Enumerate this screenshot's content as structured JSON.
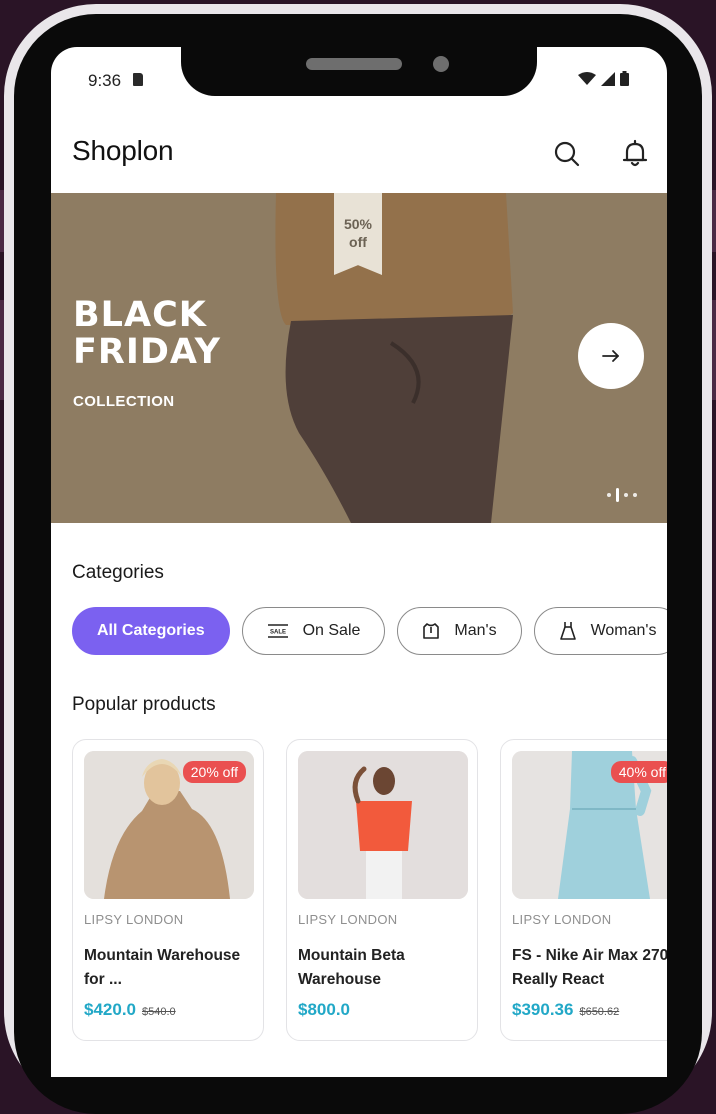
{
  "status_bar": {
    "time": "9:36"
  },
  "header": {
    "title": "Shoplon",
    "search_icon": "search-icon",
    "bell_icon": "bell-icon"
  },
  "banner": {
    "tag_line1": "50%",
    "tag_line2": "off",
    "title_line1": "BLACK",
    "title_line2": "FRIDAY",
    "subtitle": "COLLECTION"
  },
  "categories": {
    "title": "Categories",
    "items": [
      {
        "label": "All Categories",
        "active": true
      },
      {
        "label": "On Sale",
        "icon": "sale-tag-icon"
      },
      {
        "label": "Man's",
        "icon": "shirt-icon"
      },
      {
        "label": "Woman's",
        "icon": "dress-icon"
      }
    ]
  },
  "popular": {
    "title": "Popular products",
    "products": [
      {
        "brand": "LIPSY LONDON",
        "name": "Mountain Warehouse for ...",
        "price": "$420.0",
        "old_price": "$540.0",
        "discount": "20% off"
      },
      {
        "brand": "LIPSY LONDON",
        "name": "Mountain Beta Warehouse",
        "price": "$800.0",
        "old_price": "",
        "discount": ""
      },
      {
        "brand": "LIPSY LONDON",
        "name": "FS - Nike Air Max 270 Really React",
        "price": "$390.36",
        "old_price": "$650.62",
        "discount": "40% off"
      }
    ]
  },
  "colors": {
    "accent": "#7b61f0",
    "price": "#22a8c7",
    "discount": "#ea5050",
    "banner_bg": "#8e7c62"
  }
}
